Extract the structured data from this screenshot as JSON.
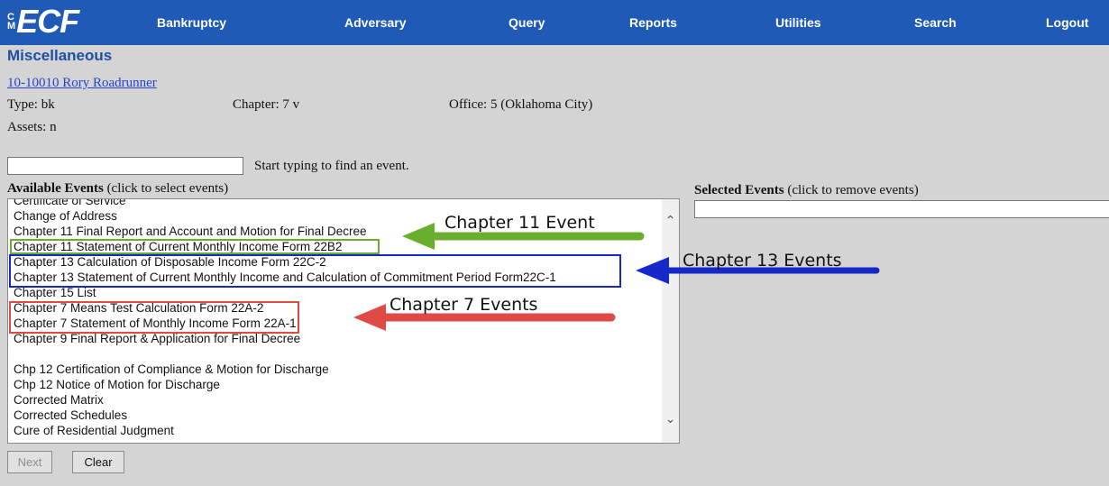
{
  "nav": {
    "logo_cm": [
      "C",
      "M"
    ],
    "logo_text": "ECF",
    "items": [
      "Bankruptcy",
      "Adversary",
      "Query",
      "Reports",
      "Utilities",
      "Search",
      "Logout"
    ]
  },
  "page": {
    "title": "Miscellaneous",
    "case_link": "10-10010 Rory Roadrunner",
    "type": "Type: bk",
    "chapter": "Chapter: 7 v",
    "office": "Office: 5 (Oklahoma City)",
    "assets": "Assets: n"
  },
  "search": {
    "value": "",
    "hint": "Start typing to find an event."
  },
  "available": {
    "title": "Available Events",
    "note": "(click to select events)",
    "events": [
      "Certificate of Service",
      "Change of Address",
      "Chapter 11 Final Report and Account and Motion for Final Decree",
      "Chapter 11 Statement of Current Monthly Income Form 22B2",
      "Chapter 13 Calculation of Disposable Income Form 22C-2",
      "Chapter 13 Statement of Current Monthly Income and Calculation of Commitment Period Form22C-1",
      "Chapter 15 List",
      "Chapter 7 Means Test Calculation Form 22A-2",
      "Chapter 7 Statement of Monthly Income Form 22A-1",
      "Chapter 9 Final Report & Application for Final Decree",
      "",
      "Chp 12 Certification of Compliance & Motion for Discharge",
      "Chp 12 Notice of Motion for Discharge",
      "Corrected Matrix",
      "Corrected Schedules",
      "Cure of Residential Judgment"
    ]
  },
  "selected": {
    "title": "Selected Events",
    "note": "(click to remove events)"
  },
  "buttons": {
    "next": "Next",
    "clear": "Clear"
  },
  "annotations": {
    "chapter11": "Chapter 11 Event",
    "chapter13": "Chapter 13 Events",
    "chapter7": "Chapter 7 Events"
  },
  "colors": {
    "nav_bg": "#1e5ab6",
    "chapter11": "#6aae2e",
    "chapter13": "#1528c8",
    "chapter7": "#e04a45"
  }
}
